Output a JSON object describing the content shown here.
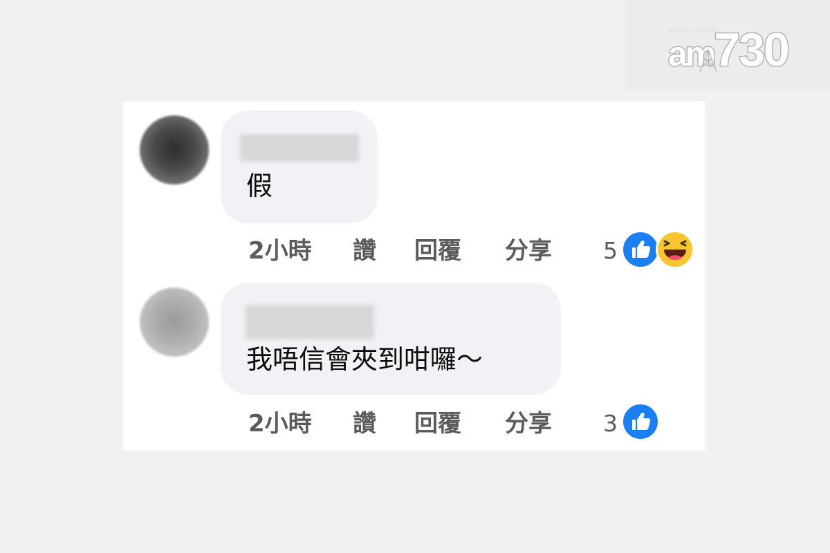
{
  "logo": {
    "tagline": "my choice · my paper",
    "brand_am": "am",
    "brand_num": "730"
  },
  "comments": [
    {
      "text": "假",
      "time": "2小時",
      "like_label": "讚",
      "reply_label": "回覆",
      "share_label": "分享",
      "reaction_count": "5",
      "reactions": [
        "like-icon",
        "haha-icon"
      ]
    },
    {
      "text": "我唔信會夾到咁囉～",
      "time": "2小時",
      "like_label": "讚",
      "reply_label": "回覆",
      "share_label": "分享",
      "reaction_count": "3",
      "reactions": [
        "like-icon"
      ]
    }
  ],
  "colors": {
    "like_blue": "#1a7ff2",
    "haha_yellow": "#f7c531",
    "bubble_bg": "#f0f2f5",
    "action_text": "#5a5b5d"
  }
}
